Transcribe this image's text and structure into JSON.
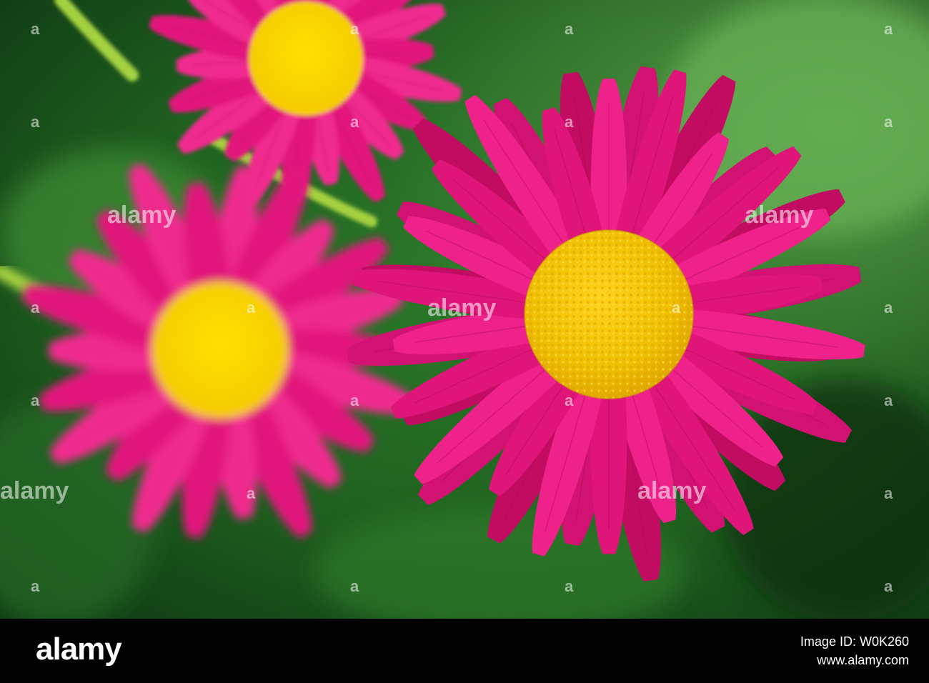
{
  "colors": {
    "background_green": "#2f7a2a",
    "dark_green": "#0e3a12",
    "petal_magenta": "#e0157a",
    "petal_highlight": "#ff3ca0",
    "center_yellow": "#f2c400",
    "center_highlight": "#ffe14a",
    "stem_green": "#9ccc3a",
    "footer_black": "#000000"
  },
  "footer": {
    "logo": "alamy",
    "image_id_label": "Image ID: W0K260",
    "url": "www.alamy.com"
  },
  "watermark": {
    "text": "alamy",
    "mark": "a"
  }
}
